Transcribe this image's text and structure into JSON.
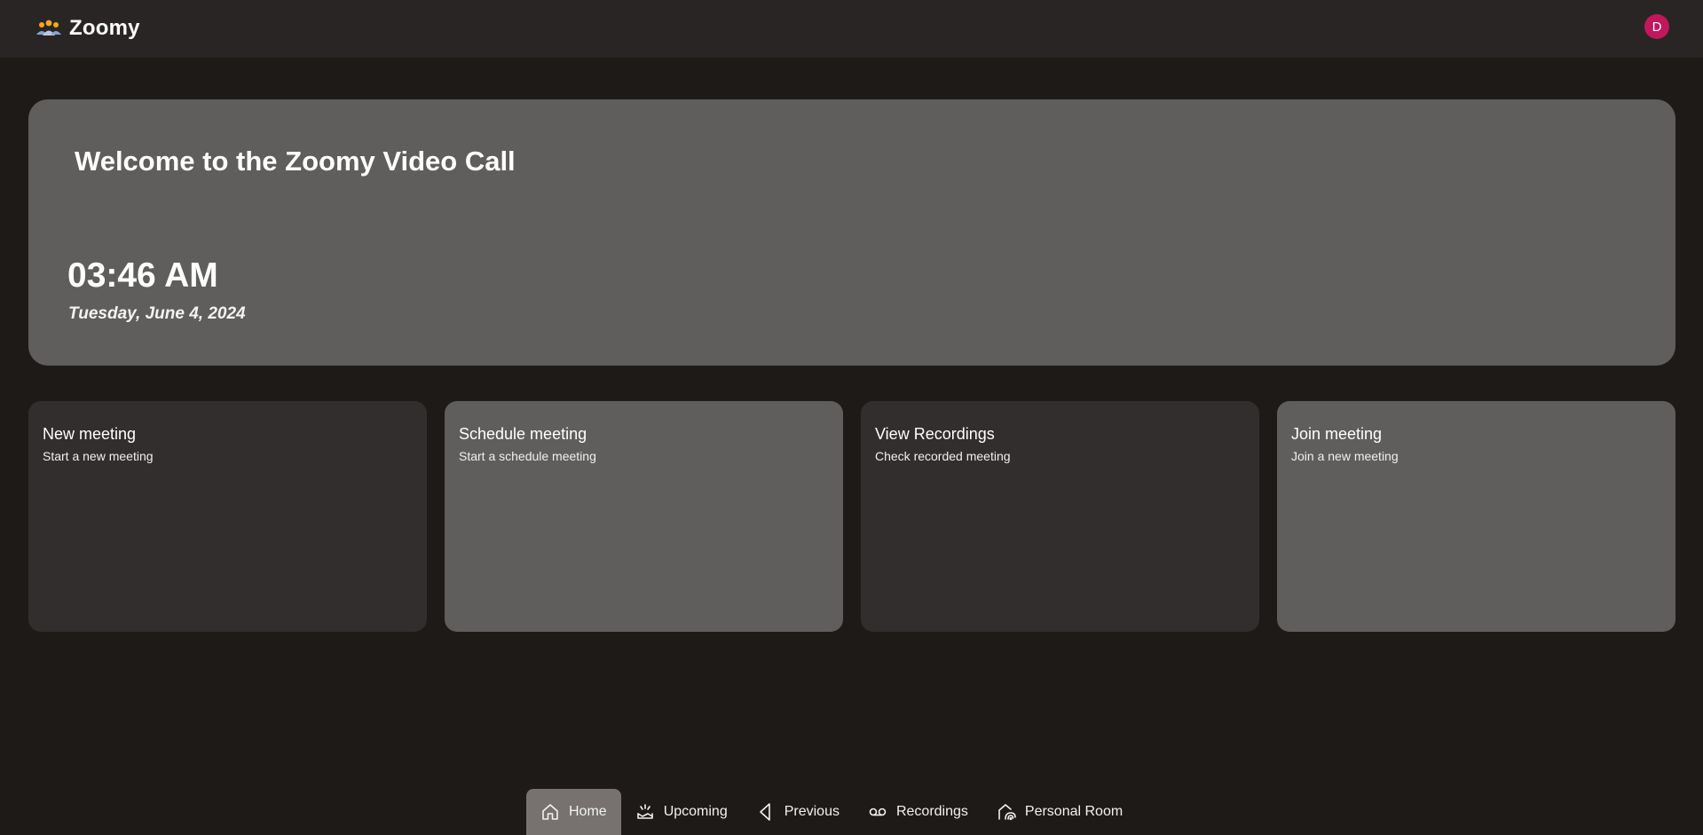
{
  "header": {
    "app_name": "Zoomy",
    "logo_icon": "people-group-icon",
    "avatar_initial": "D",
    "avatar_color": "#c0175d"
  },
  "hero": {
    "title": "Welcome to the Zoomy Video Call",
    "time": "03:46 AM",
    "date": "Tuesday, June 4, 2024"
  },
  "cards": [
    {
      "title": "New meeting",
      "subtitle": "Start a new meeting"
    },
    {
      "title": "Schedule meeting",
      "subtitle": "Start a schedule meeting"
    },
    {
      "title": "View Recordings",
      "subtitle": "Check recorded meeting"
    },
    {
      "title": "Join meeting",
      "subtitle": "Join a new meeting"
    }
  ],
  "nav": {
    "items": [
      {
        "label": "Home",
        "icon": "home-icon",
        "active": true
      },
      {
        "label": "Upcoming",
        "icon": "upcoming-icon",
        "active": false
      },
      {
        "label": "Previous",
        "icon": "previous-icon",
        "active": false
      },
      {
        "label": "Recordings",
        "icon": "recordings-icon",
        "active": false
      },
      {
        "label": "Personal Room",
        "icon": "personal-room-icon",
        "active": false
      }
    ]
  },
  "colors": {
    "background": "#1e1a18",
    "topbar": "#292524",
    "panel_light": "#5f5e5c",
    "panel_dark": "#322e2d",
    "nav_active": "#77726f",
    "logo_accent": "#f5a623"
  }
}
